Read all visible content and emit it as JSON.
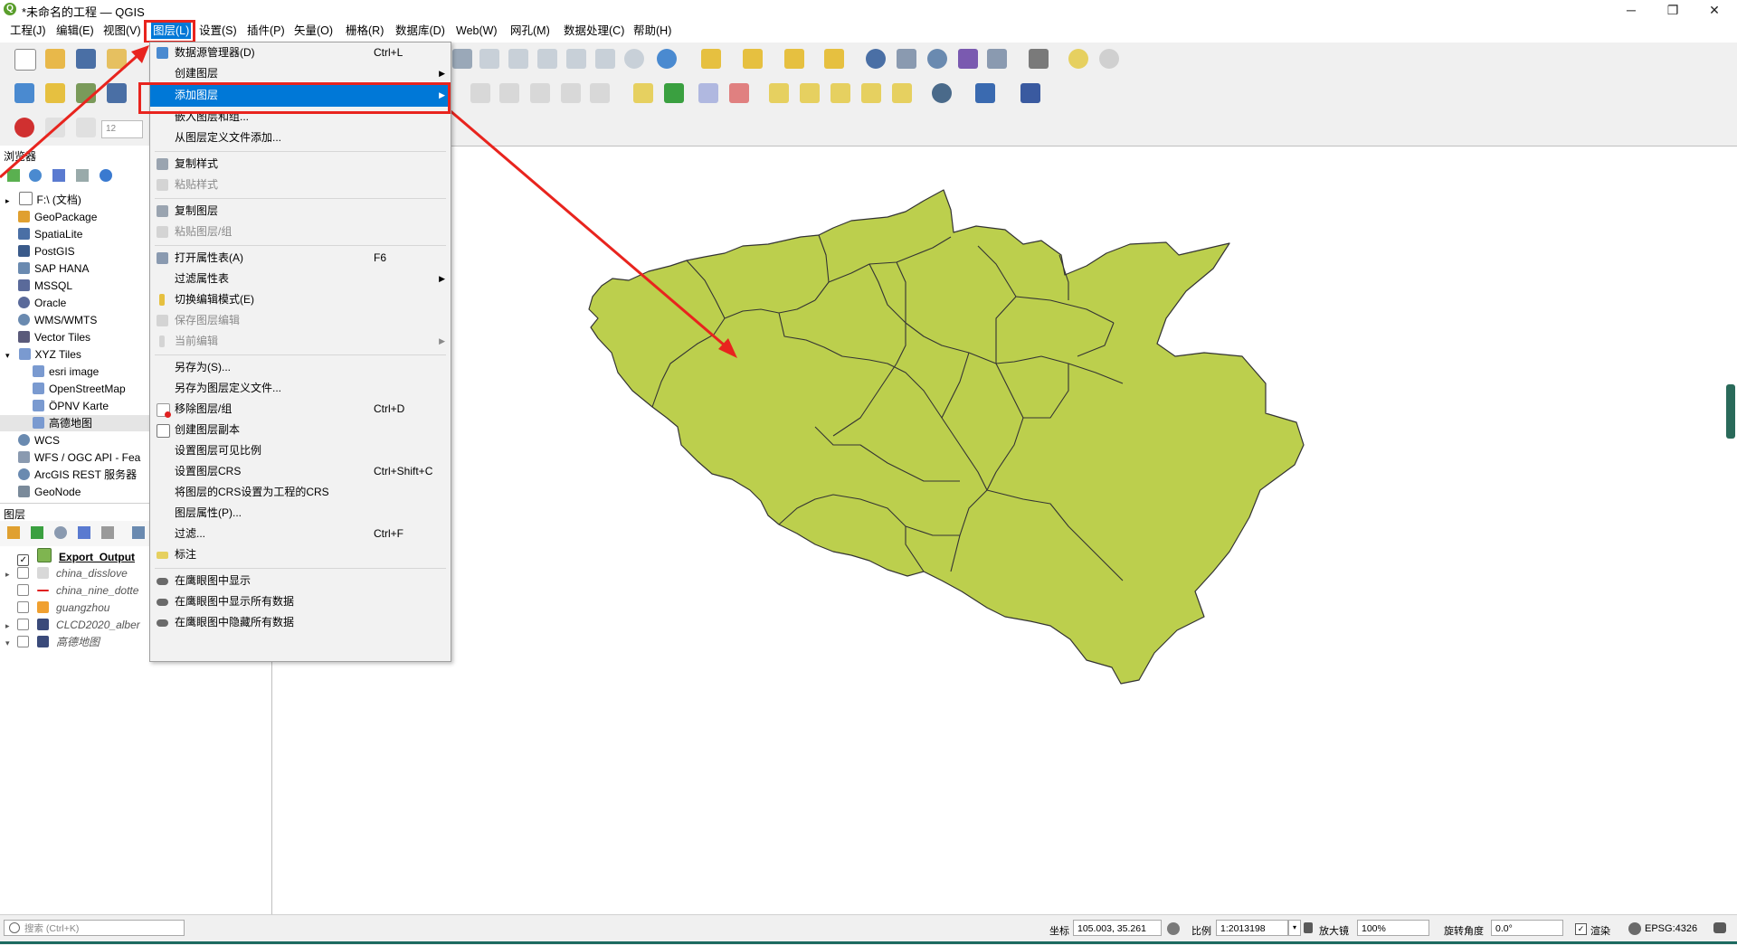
{
  "window": {
    "title": "*未命名的工程 — QGIS"
  },
  "menubar": {
    "items": [
      "工程(J)",
      "编辑(E)",
      "视图(V)",
      "图层(L)",
      "设置(S)",
      "插件(P)",
      "矢量(O)",
      "栅格(R)",
      "数据库(D)",
      "Web(W)",
      "网孔(M)",
      "数据处理(C)",
      "帮助(H)"
    ],
    "active": "图层(L)"
  },
  "toolbar": {
    "font_size_value": "12"
  },
  "browser": {
    "title": "浏览器",
    "items": [
      {
        "label": "F:\\ (文档)",
        "icon": "folder-icon"
      },
      {
        "label": "GeoPackage",
        "icon": "geopackage-icon"
      },
      {
        "label": "SpatiaLite",
        "icon": "spatialite-icon"
      },
      {
        "label": "PostGIS",
        "icon": "postgis-icon"
      },
      {
        "label": "SAP HANA",
        "icon": "sap-hana-icon"
      },
      {
        "label": "MSSQL",
        "icon": "mssql-icon"
      },
      {
        "label": "Oracle",
        "icon": "oracle-icon"
      },
      {
        "label": "WMS/WMTS",
        "icon": "wms-icon"
      },
      {
        "label": "Vector Tiles",
        "icon": "vector-tiles-icon"
      },
      {
        "label": "XYZ Tiles",
        "icon": "xyz-tiles-icon"
      },
      {
        "label": "esri image",
        "icon": "tile-icon"
      },
      {
        "label": "OpenStreetMap",
        "icon": "tile-icon"
      },
      {
        "label": "ÖPNV Karte",
        "icon": "tile-icon"
      },
      {
        "label": "高德地图",
        "icon": "tile-icon"
      },
      {
        "label": "WCS",
        "icon": "wcs-icon"
      },
      {
        "label": "WFS / OGC API - Fea",
        "icon": "wfs-icon"
      },
      {
        "label": "ArcGIS REST 服务器",
        "icon": "arcgis-icon"
      },
      {
        "label": "GeoNode",
        "icon": "geonode-icon"
      }
    ]
  },
  "layers": {
    "title": "图层",
    "items": [
      {
        "label": "Export_Output",
        "checked": true,
        "color": "#7fb550"
      },
      {
        "label": "china_disslove",
        "checked": false,
        "color": "#d8d8d8"
      },
      {
        "label": "china_nine_dotte",
        "checked": false,
        "color": "#e02020"
      },
      {
        "label": "guangzhou",
        "checked": false,
        "color": "#f0a030"
      },
      {
        "label": "CLCD2020_alber",
        "checked": false,
        "color": "#3a4a7a"
      },
      {
        "label": "高德地图",
        "checked": false,
        "color": "#3a4a7a"
      }
    ]
  },
  "layer_menu": {
    "items": [
      {
        "label": "数据源管理器(D)",
        "shortcut": "Ctrl+L",
        "icon": "datasource-manager-icon"
      },
      {
        "label": "创建图层",
        "submenu": true
      },
      {
        "label": "添加图层",
        "submenu": true,
        "highlight": true
      },
      {
        "label": "嵌入图层和组..."
      },
      {
        "label": "从图层定义文件添加..."
      },
      {
        "label": "复制样式",
        "icon": "copy-style-icon"
      },
      {
        "label": "粘贴样式",
        "disabled": true,
        "icon": "paste-style-icon"
      },
      {
        "label": "复制图层",
        "icon": "copy-layer-icon"
      },
      {
        "label": "粘贴图层/组",
        "disabled": true,
        "icon": "paste-layer-icon"
      },
      {
        "label": "打开属性表(A)",
        "shortcut": "F6",
        "icon": "attribute-table-icon"
      },
      {
        "label": "过滤属性表",
        "submenu": true
      },
      {
        "label": "切换编辑模式(E)",
        "icon": "pencil-icon"
      },
      {
        "label": "保存图层编辑",
        "disabled": true,
        "icon": "save-edits-icon"
      },
      {
        "label": "当前编辑",
        "disabled": true,
        "submenu": true,
        "icon": "current-edits-icon"
      },
      {
        "label": "另存为(S)..."
      },
      {
        "label": "另存为图层定义文件..."
      },
      {
        "label": "移除图层/组",
        "shortcut": "Ctrl+D",
        "icon": "remove-layer-icon"
      },
      {
        "label": "创建图层副本",
        "icon": "duplicate-layer-icon"
      },
      {
        "label": "设置图层可见比例"
      },
      {
        "label": "设置图层CRS",
        "shortcut": "Ctrl+Shift+C"
      },
      {
        "label": "将图层的CRS设置为工程的CRS"
      },
      {
        "label": "图层属性(P)..."
      },
      {
        "label": "过滤...",
        "shortcut": "Ctrl+F"
      },
      {
        "label": "标注",
        "icon": "label-icon"
      },
      {
        "label": "在鹰眼图中显示",
        "icon": "overview-show-icon"
      },
      {
        "label": "在鹰眼图中显示所有数据",
        "icon": "overview-show-all-icon"
      },
      {
        "label": "在鹰眼图中隐藏所有数据",
        "icon": "overview-hide-all-icon"
      }
    ]
  },
  "map": {
    "fill": "#bccf4d",
    "stroke": "#3a3a3a"
  },
  "statusbar": {
    "search_placeholder": "搜索 (Ctrl+K)",
    "coordinate_label": "坐标",
    "coordinate_value": "105.003, 35.261",
    "scale_label": "比例",
    "scale_value": "1:2013198",
    "magnifier_label": "放大镜",
    "magnifier_value": "100%",
    "rotation_label": "旋转角度",
    "rotation_value": "0.0°",
    "render_label": "渲染",
    "crs_value": "EPSG:4326"
  },
  "accent_color": "#0078d7",
  "annotation_color": "#e8241e"
}
